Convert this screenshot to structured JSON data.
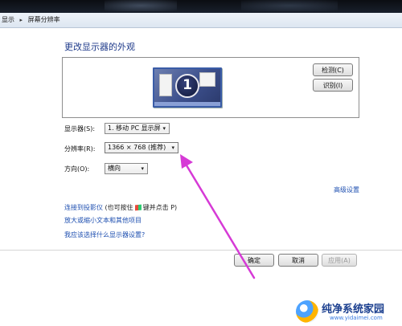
{
  "breadcrumb": {
    "items": [
      "显示",
      "屏幕分辨率"
    ],
    "separator": "▸"
  },
  "page": {
    "title": "更改显示器的外观"
  },
  "preview": {
    "monitor_number": "1"
  },
  "buttons": {
    "detect": "检测(C)",
    "identify": "识别(I)",
    "ok": "确定",
    "cancel": "取消",
    "apply": "应用(A)"
  },
  "settings": {
    "display_label": "显示器(S):",
    "display_value": "1. 移动 PC 显示屏",
    "resolution_label": "分辨率(R):",
    "resolution_value": "1366 × 768 (推荐)",
    "orientation_label": "方向(O):",
    "orientation_value": "横向"
  },
  "links": {
    "advanced": "高级设置",
    "projector": "连接到投影仪",
    "projector_hint_pre": "(也可按住",
    "projector_hint_post": "键并点击 P)",
    "text_size": "放大或缩小文本和其他项目",
    "which_settings": "我应该选择什么显示器设置?"
  },
  "icons": {
    "dropdown": "▾"
  },
  "watermark": {
    "title": "纯净系统家园",
    "url": "www.yidaimei.com"
  },
  "colors": {
    "link": "#1e4fb0",
    "heading": "#1e3a8a",
    "annotation_arrow": "#d63ad6"
  }
}
